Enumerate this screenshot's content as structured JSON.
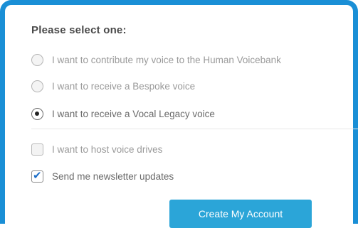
{
  "form": {
    "heading": "Please select one:",
    "radio_options": [
      {
        "label": "I want to contribute my voice to the Human Voicebank",
        "selected": false
      },
      {
        "label": "I want to receive a Bespoke voice",
        "selected": false
      },
      {
        "label": "I want to receive a Vocal Legacy voice",
        "selected": true
      }
    ],
    "checkbox_options": [
      {
        "label": "I want to host voice drives",
        "checked": false
      },
      {
        "label": "Send me newsletter updates",
        "checked": true
      }
    ],
    "submit_label": "Create My Account"
  },
  "colors": {
    "frame_border": "#1a8fd6",
    "button_bg": "#2ba5d8",
    "check_color": "#1d6fc9"
  }
}
